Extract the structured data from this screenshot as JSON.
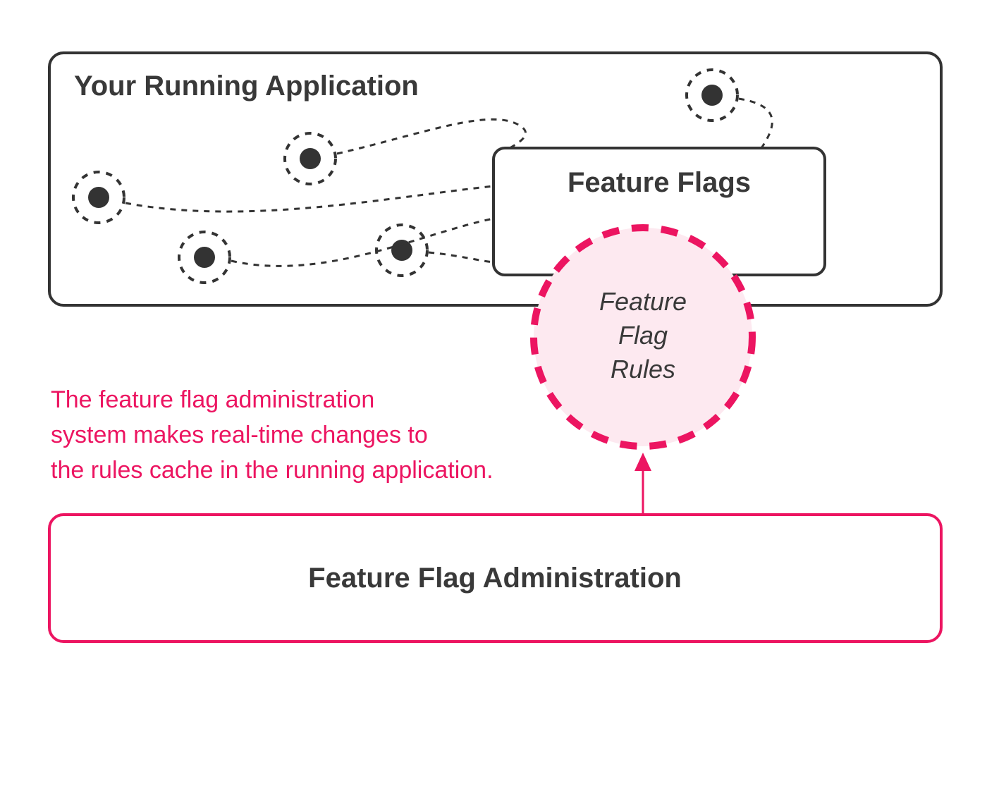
{
  "colors": {
    "text": "#393939",
    "box_stroke": "#333333",
    "pink": "#ec1561",
    "pink_fill": "#fde9f0",
    "node_fill": "#333333",
    "bg": "#ffffff"
  },
  "app_box": {
    "title": "Your Running Application"
  },
  "feature_flags_box": {
    "title": "Feature Flags"
  },
  "rules_circle": {
    "line1": "Feature",
    "line2": "Flag",
    "line3": "Rules"
  },
  "caption": {
    "line1": "The feature flag administration",
    "line2": "system makes real-time changes to",
    "line3": "the rules cache in the running application."
  },
  "admin_box": {
    "title": "Feature Flag Administration"
  }
}
